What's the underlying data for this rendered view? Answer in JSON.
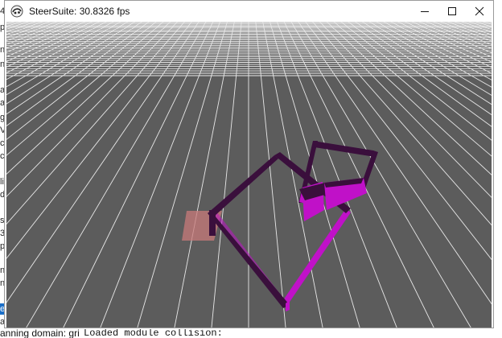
{
  "window": {
    "title": "SteerSuite: 30.8326 fps",
    "controls": [
      {
        "name": "minimize",
        "icon": "minimize-icon"
      },
      {
        "name": "maximize",
        "icon": "maximize-icon"
      },
      {
        "name": "close",
        "icon": "close-icon"
      }
    ]
  },
  "scene": {
    "background_color": "#5c5c5c",
    "grid_color": "#e8e8e8",
    "highlight_tile_color": "#c87a7a",
    "obstacle_color_top": "#3a0f3c",
    "obstacle_color_side": "#c011c8"
  },
  "background": {
    "left_chars": [
      "4",
      "p",
      "n",
      "n",
      "a",
      "a",
      "g",
      "V",
      "c",
      "c",
      "li",
      "d",
      "s",
      "3",
      "p",
      "n",
      "n",
      "e",
      "a"
    ],
    "bottom_left_text": "anning domain: gri",
    "bottom_console_text": "Loaded module collision:"
  }
}
